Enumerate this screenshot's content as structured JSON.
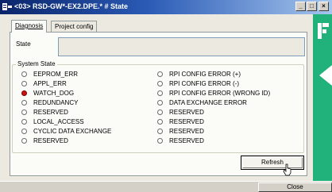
{
  "window": {
    "title": "<03> RSD-GW*-EX2.DPE.* # State"
  },
  "controls": {
    "minimize": "_",
    "maximize": "□",
    "close": "×"
  },
  "tabs": [
    {
      "label": "Diagnosis",
      "active": true
    },
    {
      "label": "Project config",
      "active": false
    }
  ],
  "state": {
    "label": "State",
    "value": ""
  },
  "system_state": {
    "title": "System State",
    "left": [
      {
        "label": "EEPROM_ERR",
        "active": false
      },
      {
        "label": "APPL_ERR",
        "active": false
      },
      {
        "label": "WATCH_DOG",
        "active": true
      },
      {
        "label": "REDUNDANCY",
        "active": false
      },
      {
        "label": "RESERVED",
        "active": false
      },
      {
        "label": "LOCAL_ACCESS",
        "active": false
      },
      {
        "label": "CYCLIC DATA EXCHANGE",
        "active": false
      },
      {
        "label": "RESERVED",
        "active": false
      }
    ],
    "right": [
      {
        "label": "RPI CONFIG ERROR (+)",
        "active": false
      },
      {
        "label": "RPI CONFIG ERROR (-)",
        "active": false
      },
      {
        "label": "RPI CONFIG ERROR (WRONG ID)",
        "active": false
      },
      {
        "label": "DATA EXCHANGE ERROR",
        "active": false
      },
      {
        "label": "RESERVED",
        "active": false
      },
      {
        "label": "RESERVED",
        "active": false
      },
      {
        "label": "RESERVED",
        "active": false
      },
      {
        "label": "RESERVED",
        "active": false
      }
    ]
  },
  "buttons": {
    "refresh": "Refresh",
    "close": "Close"
  },
  "colors": {
    "led_active": "#cc1111",
    "side_strip": "#20b27a",
    "titlebar": "#0a246a"
  },
  "icons": [
    "app-icon",
    "led-indicator-icon",
    "pointer-cursor-icon",
    "vendor-logo-icon",
    "side-arrow-icon"
  ]
}
